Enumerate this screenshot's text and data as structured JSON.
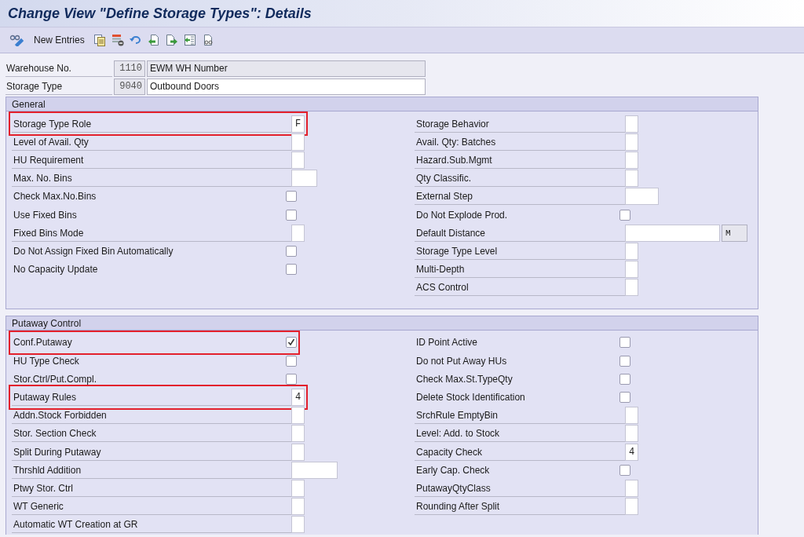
{
  "window": {
    "title": "Change View \"Define Storage Types\": Details"
  },
  "toolbar": {
    "items": [
      {
        "kind": "display-change"
      },
      {
        "kind": "text",
        "label": "New Entries"
      },
      {
        "kind": "copy"
      },
      {
        "kind": "delete"
      },
      {
        "kind": "undo"
      },
      {
        "kind": "previous"
      },
      {
        "kind": "next"
      },
      {
        "kind": "variable-list"
      },
      {
        "kind": "print"
      }
    ]
  },
  "header_fields": [
    {
      "label": "Warehouse No.",
      "value": "1110",
      "description": "EWM WH Number",
      "editable": false
    },
    {
      "label": "Storage Type",
      "value": "9040",
      "description": "Outbound Doors",
      "editable": true
    }
  ],
  "sections": [
    {
      "title": "General",
      "columns": [
        [
          {
            "label": "Storage Type Role",
            "kind": "flag",
            "value": "F",
            "highlighted": true
          },
          {
            "label": "Level of Avail. Qty",
            "kind": "flag",
            "highlighted": false
          },
          {
            "label": "HU Requirement",
            "kind": "flag",
            "highlighted": false
          },
          {
            "label": "Max. No. Bins",
            "kind": "number",
            "highlighted": false
          },
          {
            "label": "Check Max.No.Bins",
            "kind": "checkbox",
            "checked": false,
            "highlighted": false
          },
          {
            "label": "Use Fixed Bins",
            "kind": "checkbox",
            "checked": false,
            "highlighted": false
          },
          {
            "label": "Fixed Bins Mode",
            "kind": "flag",
            "highlighted": false
          },
          {
            "label": "Do Not Assign Fixed Bin Automatically",
            "kind": "checkbox",
            "checked": false,
            "highlighted": false
          },
          {
            "label": "No Capacity Update",
            "kind": "checkbox",
            "checked": false,
            "highlighted": false
          }
        ],
        [
          {
            "label": "Storage Behavior",
            "kind": "flag",
            "highlighted": false
          },
          {
            "label": "Avail. Qty: Batches",
            "kind": "flag",
            "highlighted": false
          },
          {
            "label": "Hazard.Sub.Mgmt",
            "kind": "flag",
            "highlighted": false
          },
          {
            "label": "Qty Classific.",
            "kind": "flag",
            "highlighted": false
          },
          {
            "label": "External Step",
            "kind": "code",
            "highlighted": false
          },
          {
            "label": "Do Not Explode Prod.",
            "kind": "checkbox",
            "checked": false,
            "highlighted": false
          },
          {
            "label": "Default Distance",
            "kind": "quantity",
            "unit": "M",
            "highlighted": false
          },
          {
            "label": "Storage Type Level",
            "kind": "flag",
            "highlighted": false
          },
          {
            "label": "Multi-Depth",
            "kind": "flag",
            "highlighted": false
          },
          {
            "label": "ACS Control",
            "kind": "flag",
            "highlighted": false
          }
        ]
      ]
    },
    {
      "title": "Putaway Control",
      "columns": [
        [
          {
            "label": "Conf.Putaway",
            "kind": "checkbox",
            "checked": true,
            "highlighted": true
          },
          {
            "label": "HU Type Check",
            "kind": "checkbox",
            "checked": false,
            "highlighted": false
          },
          {
            "label": "Stor.Ctrl/Put.Compl.",
            "kind": "checkbox",
            "checked": false,
            "highlighted": false
          },
          {
            "label": "Putaway Rules",
            "kind": "flag",
            "value": "4",
            "highlighted": true
          },
          {
            "label": "Addn.Stock Forbidden",
            "kind": "flag",
            "highlighted": false
          },
          {
            "label": "Stor. Section Check",
            "kind": "flag",
            "highlighted": false
          },
          {
            "label": "Split During Putaway",
            "kind": "flag",
            "highlighted": false
          },
          {
            "label": "Thrshld Addition",
            "kind": "decimal",
            "highlighted": false
          },
          {
            "label": "Ptwy Stor. Ctrl",
            "kind": "flag",
            "highlighted": false
          },
          {
            "label": "WT Generic",
            "kind": "flag",
            "highlighted": false
          },
          {
            "label": "Automatic WT Creation at GR",
            "kind": "flag",
            "highlighted": false
          }
        ],
        [
          {
            "label": "ID Point Active",
            "kind": "checkbox",
            "checked": false,
            "highlighted": false
          },
          {
            "label": "Do not Put Away HUs",
            "kind": "checkbox",
            "checked": false,
            "highlighted": false
          },
          {
            "label": "Check Max.St.TypeQty",
            "kind": "checkbox",
            "checked": false,
            "highlighted": false
          },
          {
            "label": "Delete Stock Identification",
            "kind": "checkbox",
            "checked": false,
            "highlighted": false
          },
          {
            "label": "SrchRule EmptyBin",
            "kind": "flag",
            "highlighted": false
          },
          {
            "label": "Level: Add. to Stock",
            "kind": "flag",
            "highlighted": false
          },
          {
            "label": "Capacity Check",
            "kind": "flag",
            "value": "4",
            "highlighted": false
          },
          {
            "label": "Early Cap. Check",
            "kind": "checkbox",
            "checked": false,
            "highlighted": false
          },
          {
            "label": "PutawayQtyClass",
            "kind": "flag",
            "highlighted": false
          },
          {
            "label": "Rounding After Split",
            "kind": "flag",
            "highlighted": false
          }
        ]
      ]
    }
  ]
}
